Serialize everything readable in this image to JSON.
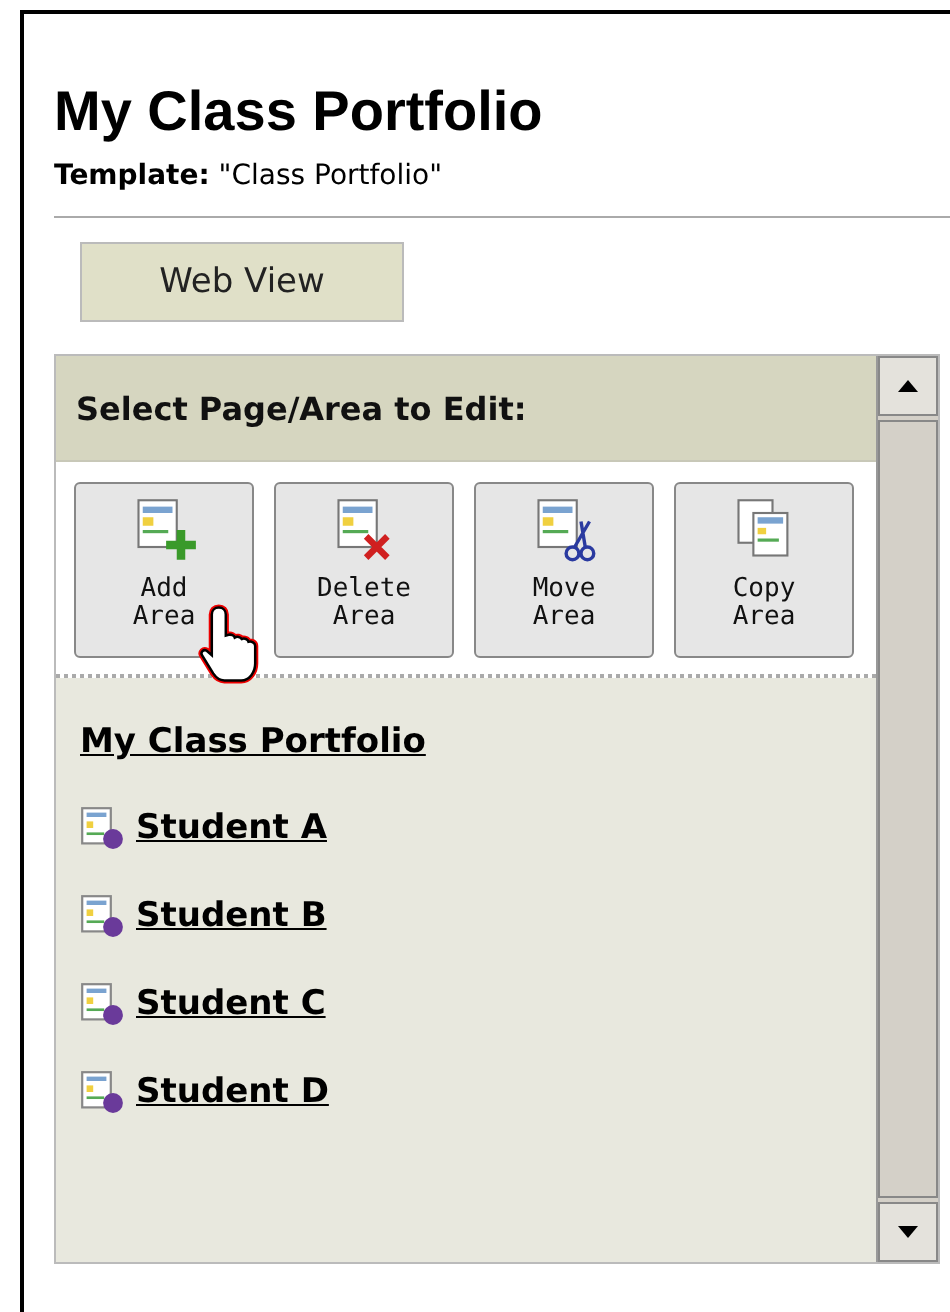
{
  "title": "My Class Portfolio",
  "template": "**Template:** \"Class Portfolio\"",
  "view_button": "Web View",
  "panel": {
    "heading": "Select Page/Area to Edit:",
    "tools": [
      {
        "kind": "add",
        "label": [
          "Add",
          "Area"
        ]
      },
      {
        "kind": "delete",
        "label": [
          "Delete",
          "Area"
        ]
      },
      {
        "kind": "move",
        "label": [
          "Move",
          "Area"
        ]
      },
      {
        "kind": "copy",
        "label": [
          "Copy",
          "Area"
        ]
      }
    ],
    "root_page": "My Class Portfolio",
    "areas": [
      "Student A",
      "Student B",
      "Student C",
      "Student D"
    ]
  }
}
